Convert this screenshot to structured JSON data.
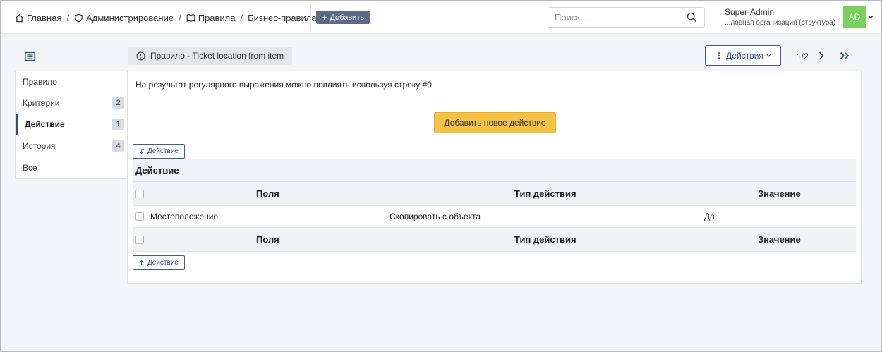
{
  "breadcrumb": {
    "home": "Главная",
    "admin": "Администрирование",
    "rules": "Правила",
    "current": "Бизнес-правила..."
  },
  "header": {
    "add_label": "Добавить",
    "search_placeholder": "Поиск...",
    "user_name": "Super-Admin",
    "user_org": "...ловная организация (структура)",
    "avatar_initials": "AD"
  },
  "toolbar": {
    "item_title": "Правило - Ticket location from item",
    "actions_label": "Действия",
    "pager": "1/2"
  },
  "tabs": [
    {
      "label": "Правило",
      "badge": ""
    },
    {
      "label": "Критерии",
      "badge": "2"
    },
    {
      "label": "Действие",
      "badge": "1"
    },
    {
      "label": "История",
      "badge": "4"
    },
    {
      "label": "Все",
      "badge": ""
    }
  ],
  "main": {
    "info_text": "На результат регулярного выражения можно повлиять используя строку #0",
    "add_action_label": "Добавить новое действие",
    "mini_button_label": "Действие",
    "table": {
      "caption": "Действие",
      "headers": [
        "Поля",
        "Тип действия",
        "Значение"
      ],
      "rows": [
        [
          "Местоположение",
          "Скопировать с объекта",
          "Да"
        ]
      ]
    }
  },
  "colors": {
    "accent": "#5c6a89",
    "add_action": "#f6c245",
    "avatar": "#77d15b"
  }
}
